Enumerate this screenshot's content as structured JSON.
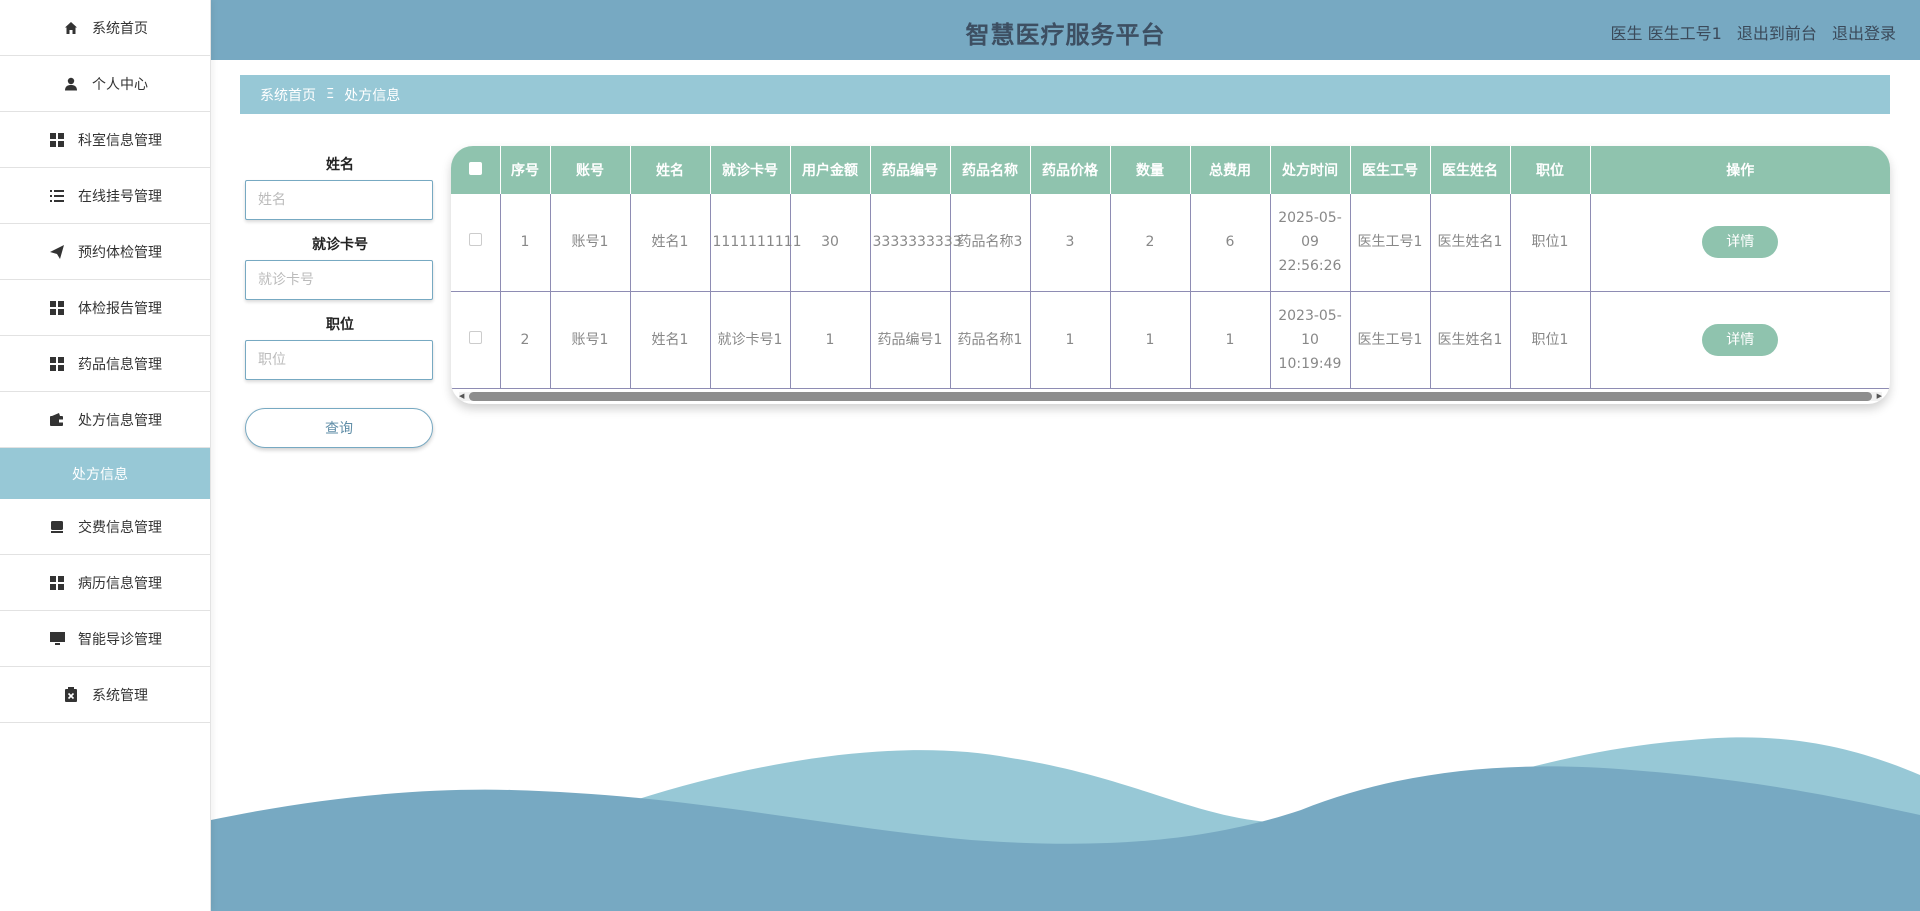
{
  "sidebar": {
    "items": [
      {
        "label": "系统首页",
        "icon": "home-icon"
      },
      {
        "label": "个人中心",
        "icon": "user-icon"
      },
      {
        "label": "科室信息管理",
        "icon": "grid-icon"
      },
      {
        "label": "在线挂号管理",
        "icon": "list-icon"
      },
      {
        "label": "预约体检管理",
        "icon": "paper-plane-icon"
      },
      {
        "label": "体检报告管理",
        "icon": "grid-icon"
      },
      {
        "label": "药品信息管理",
        "icon": "grid-icon"
      },
      {
        "label": "处方信息管理",
        "icon": "wallet-icon"
      },
      {
        "label": "交费信息管理",
        "icon": "store-icon"
      },
      {
        "label": "病历信息管理",
        "icon": "grid-icon"
      },
      {
        "label": "智能导诊管理",
        "icon": "monitor-icon"
      },
      {
        "label": "系统管理",
        "icon": "clipboard-icon"
      }
    ],
    "active_sub": "处方信息"
  },
  "header": {
    "title": "智慧医疗服务平台",
    "user": "医生 医生工号1",
    "front_link": "退出到前台",
    "logout_link": "退出登录"
  },
  "breadcrumb": {
    "home": "系统首页",
    "separator": "Ξ",
    "current": "处方信息"
  },
  "search": {
    "name_label": "姓名",
    "name_placeholder": "姓名",
    "card_label": "就诊卡号",
    "card_placeholder": "就诊卡号",
    "position_label": "职位",
    "position_placeholder": "职位",
    "query_button": "查询"
  },
  "table": {
    "headers": [
      "序号",
      "账号",
      "姓名",
      "就诊卡号",
      "用户金额",
      "药品编号",
      "药品名称",
      "药品价格",
      "数量",
      "总费用",
      "处方时间",
      "医生工号",
      "医生姓名",
      "职位",
      "操作"
    ],
    "rows": [
      [
        "1",
        "账号1",
        "姓名1",
        "1111111111",
        "30",
        "3333333333",
        "药品名称3",
        "3",
        "2",
        "6",
        "2025-05-09 22:56:26",
        "医生工号1",
        "医生姓名1",
        "职位1"
      ],
      [
        "2",
        "账号1",
        "姓名1",
        "就诊卡号1",
        "1",
        "药品编号1",
        "药品名称1",
        "1",
        "1",
        "1",
        "2023-05-10 10:19:49",
        "医生工号1",
        "医生姓名1",
        "职位1"
      ]
    ],
    "detail_label": "详情"
  },
  "colors": {
    "header": "#77a9c2",
    "breadcrumb": "#97c8d6",
    "table_header": "#8fc3ae",
    "wave_light": "#97c8d6",
    "wave_dark": "#77a9c2"
  }
}
